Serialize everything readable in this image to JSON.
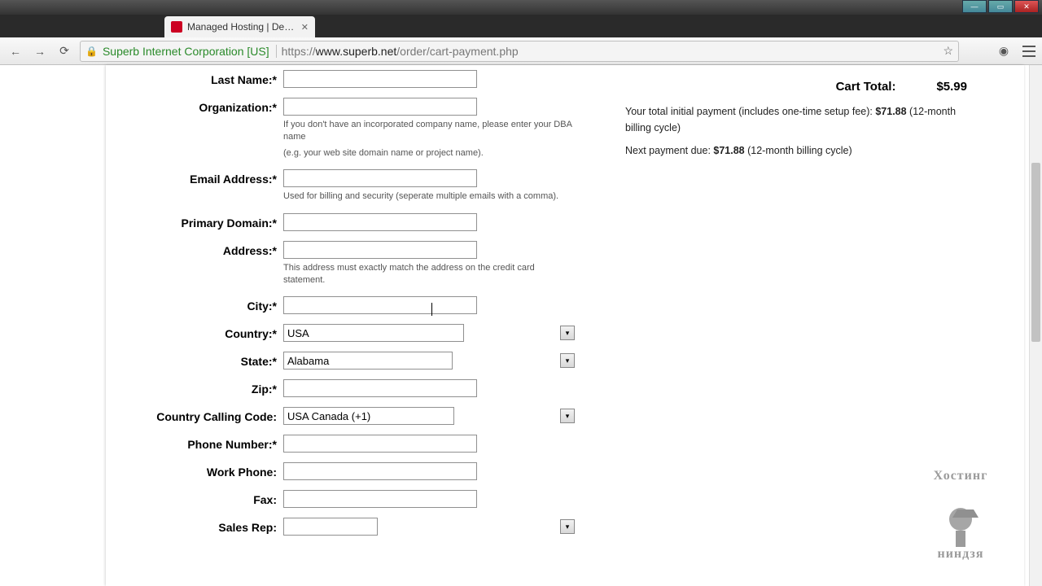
{
  "window": {
    "tab_title": "Managed Hosting | Dedic"
  },
  "address": {
    "ssl_org": "Superb Internet Corporation [US]",
    "url_prefix": "https://",
    "url_host": "www.superb.net",
    "url_path": "/order/cart-payment.php"
  },
  "form": {
    "last_name": {
      "label": "Last Name:*",
      "value": ""
    },
    "organization": {
      "label": "Organization:*",
      "value": "",
      "help1": "If you don't have an incorporated company name, please enter your DBA name",
      "help2": "(e.g. your web site domain name or project name)."
    },
    "email": {
      "label": "Email Address:*",
      "value": "",
      "help": "Used for billing and security (seperate multiple emails with a comma)."
    },
    "primary_domain": {
      "label": "Primary Domain:*",
      "value": ""
    },
    "address": {
      "label": "Address:*",
      "value": "",
      "help": "This address must exactly match the address on the credit card statement."
    },
    "city": {
      "label": "City:*",
      "value": ""
    },
    "country": {
      "label": "Country:*",
      "value": "USA"
    },
    "state": {
      "label": "State:*",
      "value": "Alabama"
    },
    "zip": {
      "label": "Zip:*",
      "value": ""
    },
    "ccc": {
      "label": "Country Calling Code:",
      "value": "USA Canada (+1)"
    },
    "phone": {
      "label": "Phone Number:*",
      "value": ""
    },
    "work_phone": {
      "label": "Work Phone:",
      "value": ""
    },
    "fax": {
      "label": "Fax:",
      "value": ""
    },
    "sales_rep": {
      "label": "Sales Rep:",
      "value": ""
    }
  },
  "sidebar": {
    "cart_total_label": "Cart Total:",
    "cart_total_amount": "$5.99",
    "line1_a": "Your total initial payment (includes one-time setup fee): ",
    "line1_b": "$71.88",
    "line1_c": " (12-month billing cycle)",
    "line2_a": "Next payment due: ",
    "line2_b": "$71.88",
    "line2_c": " (12-month billing cycle)"
  },
  "watermark": {
    "top": "Хостинг",
    "bottom": "ниндзя"
  }
}
